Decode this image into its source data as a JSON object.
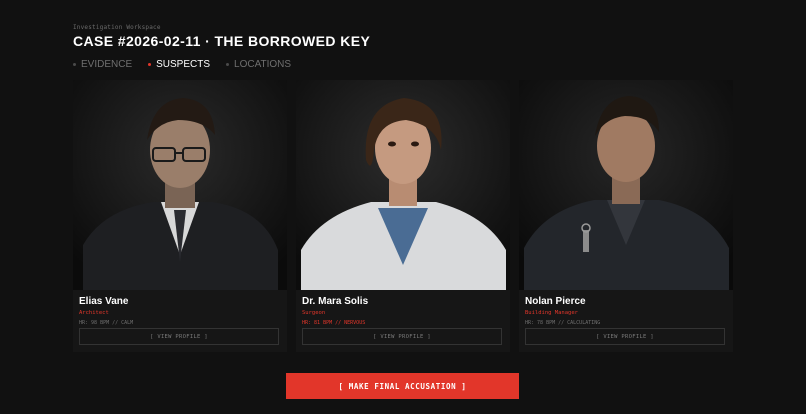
{
  "header": {
    "workspace_label": "Investigation Workspace",
    "case_title": "CASE #2026-02-11 · THE BORROWED KEY"
  },
  "tabs": [
    {
      "label": "EVIDENCE",
      "active": false
    },
    {
      "label": "SUSPECTS",
      "active": true
    },
    {
      "label": "LOCATIONS",
      "active": false
    }
  ],
  "suspects": [
    {
      "name": "Elias Vane",
      "role": "Architect",
      "vitals": "HR: 98 BPM // CALM",
      "button_label": "[ VIEW PROFILE ]"
    },
    {
      "name": "Dr. Mara Solis",
      "role": "Surgeon",
      "vitals": "HR: 81 BPM // NERVOUS",
      "button_label": "[ VIEW PROFILE ]"
    },
    {
      "name": "Nolan Pierce",
      "role": "Building Manager",
      "vitals": "HR: 78 BPM // CALCULATING",
      "button_label": "[ VIEW PROFILE ]"
    }
  ],
  "actions": {
    "accuse_label": "[ MAKE FINAL ACCUSATION ]"
  },
  "colors": {
    "background": "#111111",
    "accent": "#e2362a",
    "muted": "#6f6f6f"
  }
}
